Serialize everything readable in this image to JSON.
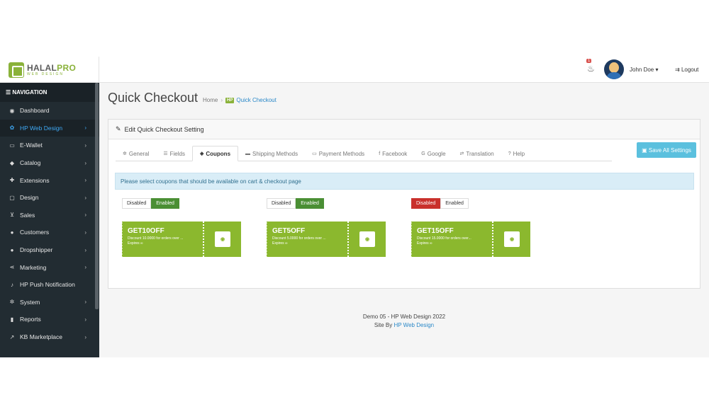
{
  "header": {
    "brand_name": "HALAL",
    "brand_name_accent": "PRO",
    "brand_sub": "WEB DESIGN",
    "notification_count": "1",
    "user_name": "John Doe ▾",
    "logout_label": "Logout"
  },
  "sidebar": {
    "header": "NAVIGATION",
    "items": [
      {
        "label": "Dashboard",
        "icon": "dashboard-icon",
        "glyph": "◉",
        "chevron": ""
      },
      {
        "label": "HP Web Design",
        "icon": "cogs-icon",
        "glyph": "✿",
        "chevron": "›"
      },
      {
        "label": "E-Wallet",
        "icon": "credit-card-icon",
        "glyph": "▭",
        "chevron": "›"
      },
      {
        "label": "Catalog",
        "icon": "tag-icon",
        "glyph": "◆",
        "chevron": "›"
      },
      {
        "label": "Extensions",
        "icon": "puzzle-icon",
        "glyph": "✚",
        "chevron": "›"
      },
      {
        "label": "Design",
        "icon": "monitor-icon",
        "glyph": "▢",
        "chevron": "›"
      },
      {
        "label": "Sales",
        "icon": "cart-icon",
        "glyph": "⊻",
        "chevron": "›"
      },
      {
        "label": "Customers",
        "icon": "user-icon",
        "glyph": "●",
        "chevron": "›"
      },
      {
        "label": "Dropshipper",
        "icon": "users-icon",
        "glyph": "●",
        "chevron": "›"
      },
      {
        "label": "Marketing",
        "icon": "share-icon",
        "glyph": "⋖",
        "chevron": "›"
      },
      {
        "label": "HP Push Notification",
        "icon": "bell-icon",
        "glyph": "♪",
        "chevron": ""
      },
      {
        "label": "System",
        "icon": "gear-icon",
        "glyph": "✲",
        "chevron": "›"
      },
      {
        "label": "Reports",
        "icon": "bar-chart-icon",
        "glyph": "▮",
        "chevron": "›"
      },
      {
        "label": "KB Marketplace",
        "icon": "line-chart-icon",
        "glyph": "↗",
        "chevron": "›"
      }
    ]
  },
  "page": {
    "title": "Quick Checkout",
    "breadcrumb_home": "Home",
    "breadcrumb_badge": "HP",
    "breadcrumb_current": "Quick Checkout"
  },
  "panel": {
    "heading": "Edit Quick Checkout Setting",
    "save_label": "Save All Settings",
    "tabs": [
      {
        "label": "General",
        "glyph": "✲"
      },
      {
        "label": "Fields",
        "glyph": "☰"
      },
      {
        "label": "Coupons",
        "glyph": "◈"
      },
      {
        "label": "Shipping Methods",
        "glyph": "▬"
      },
      {
        "label": "Payment Methods",
        "glyph": "▭"
      },
      {
        "label": "Facebook",
        "glyph": "f"
      },
      {
        "label": "Google",
        "glyph": "G"
      },
      {
        "label": "Translation",
        "glyph": "⇄"
      },
      {
        "label": "Help",
        "glyph": "?"
      }
    ],
    "alert": "Please select coupons that should be available on cart & checkout page",
    "coupons": [
      {
        "disabled_label": "Disabled",
        "enabled_label": "Enabled",
        "state": "enabled",
        "code": "GET10OFF",
        "description": "Discount 10.0000 for orders over ...",
        "expires": "Expires ∞"
      },
      {
        "disabled_label": "Disabled",
        "enabled_label": "Enabled",
        "state": "enabled",
        "code": "GET5OFF",
        "description": "Discount 5.0000 for orders over ...",
        "expires": "Expires ∞"
      },
      {
        "disabled_label": "Disabled",
        "enabled_label": "Enabled",
        "state": "disabled",
        "code": "GET15OFF",
        "description": "Discount 15.0000 for orders over...",
        "expires": "Expires ∞"
      }
    ]
  },
  "footer": {
    "line1": "Demo 05 - HP Web Design 2022",
    "line2_prefix": "Site By",
    "line2_link": "HP Web Design"
  },
  "colors": {
    "sidebar_bg": "#222c32",
    "active_link": "#3fa9f5",
    "brand_green": "#8ab23a",
    "coupon_green": "#8bb82e",
    "enabled_green": "#4a8f34",
    "disabled_red": "#c9302c",
    "save_button": "#5bc0de"
  }
}
